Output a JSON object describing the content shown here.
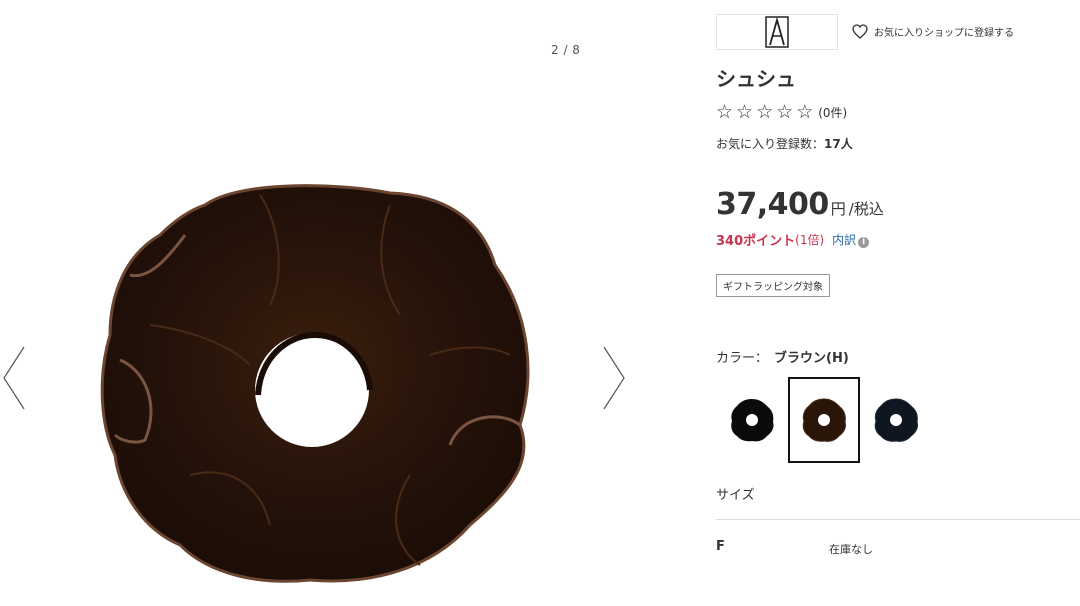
{
  "gallery": {
    "counter": "2 / 8",
    "icons": {
      "prev": "chevron-left-icon",
      "next": "chevron-right-icon"
    }
  },
  "product": {
    "brand_logo": "brand-logo",
    "favorite_shop_label": "お気に入りショップに登録する",
    "title": "シュシュ",
    "rating": {
      "stars": 0,
      "max": 5,
      "count_label": "(0件)"
    },
    "favorites": {
      "label": "お気に入り登録数：",
      "count": "17人"
    },
    "price": {
      "amount": "37,400",
      "unit": "円",
      "tax": "/税込"
    },
    "points": {
      "amount": "340ポイント",
      "multiplier": "(1倍)",
      "detail_link": "内訳",
      "info_icon": "i"
    },
    "gift_tag": "ギフトラッピング対象",
    "color": {
      "label": "カラー：",
      "selected": "ブラウン(H)"
    },
    "swatches": [
      {
        "name": "black",
        "fill": "#0b0b0b",
        "selected": false
      },
      {
        "name": "brown",
        "fill": "#2a1608",
        "selected": true
      },
      {
        "name": "navy",
        "fill": "#0e1622",
        "selected": false
      }
    ],
    "size": {
      "label": "サイズ",
      "rows": [
        {
          "size": "F",
          "stock": "在庫なし"
        }
      ]
    }
  },
  "colors": {
    "points_red": "#c8344e",
    "link_blue": "#2a6aa8",
    "scrunchie_brown": "#2b1608",
    "scrunchie_edge": "#7a4e35"
  }
}
